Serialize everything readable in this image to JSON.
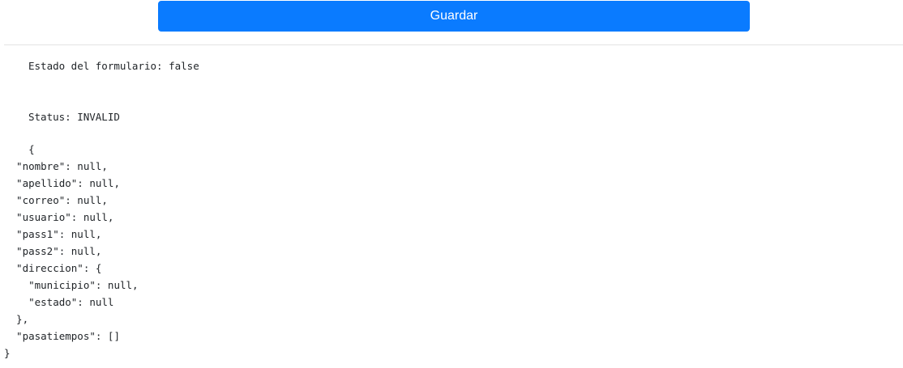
{
  "actions": {
    "save_label": "Guardar"
  },
  "form": {
    "state_line": "Estado del formulario: false",
    "status_line": "Status: INVALID",
    "json_lines": [
      "    {",
      "  \"nombre\": null,",
      "  \"apellido\": null,",
      "  \"correo\": null,",
      "  \"usuario\": null,",
      "  \"pass1\": null,",
      "  \"pass2\": null,",
      "  \"direccion\": {",
      "    \"municipio\": null,",
      "    \"estado\": null",
      "  },",
      "  \"pasatiempos\": []",
      "}"
    ]
  },
  "colors": {
    "primary": "#0a7bff",
    "text": "#212529",
    "divider": "#e3e3e3"
  }
}
